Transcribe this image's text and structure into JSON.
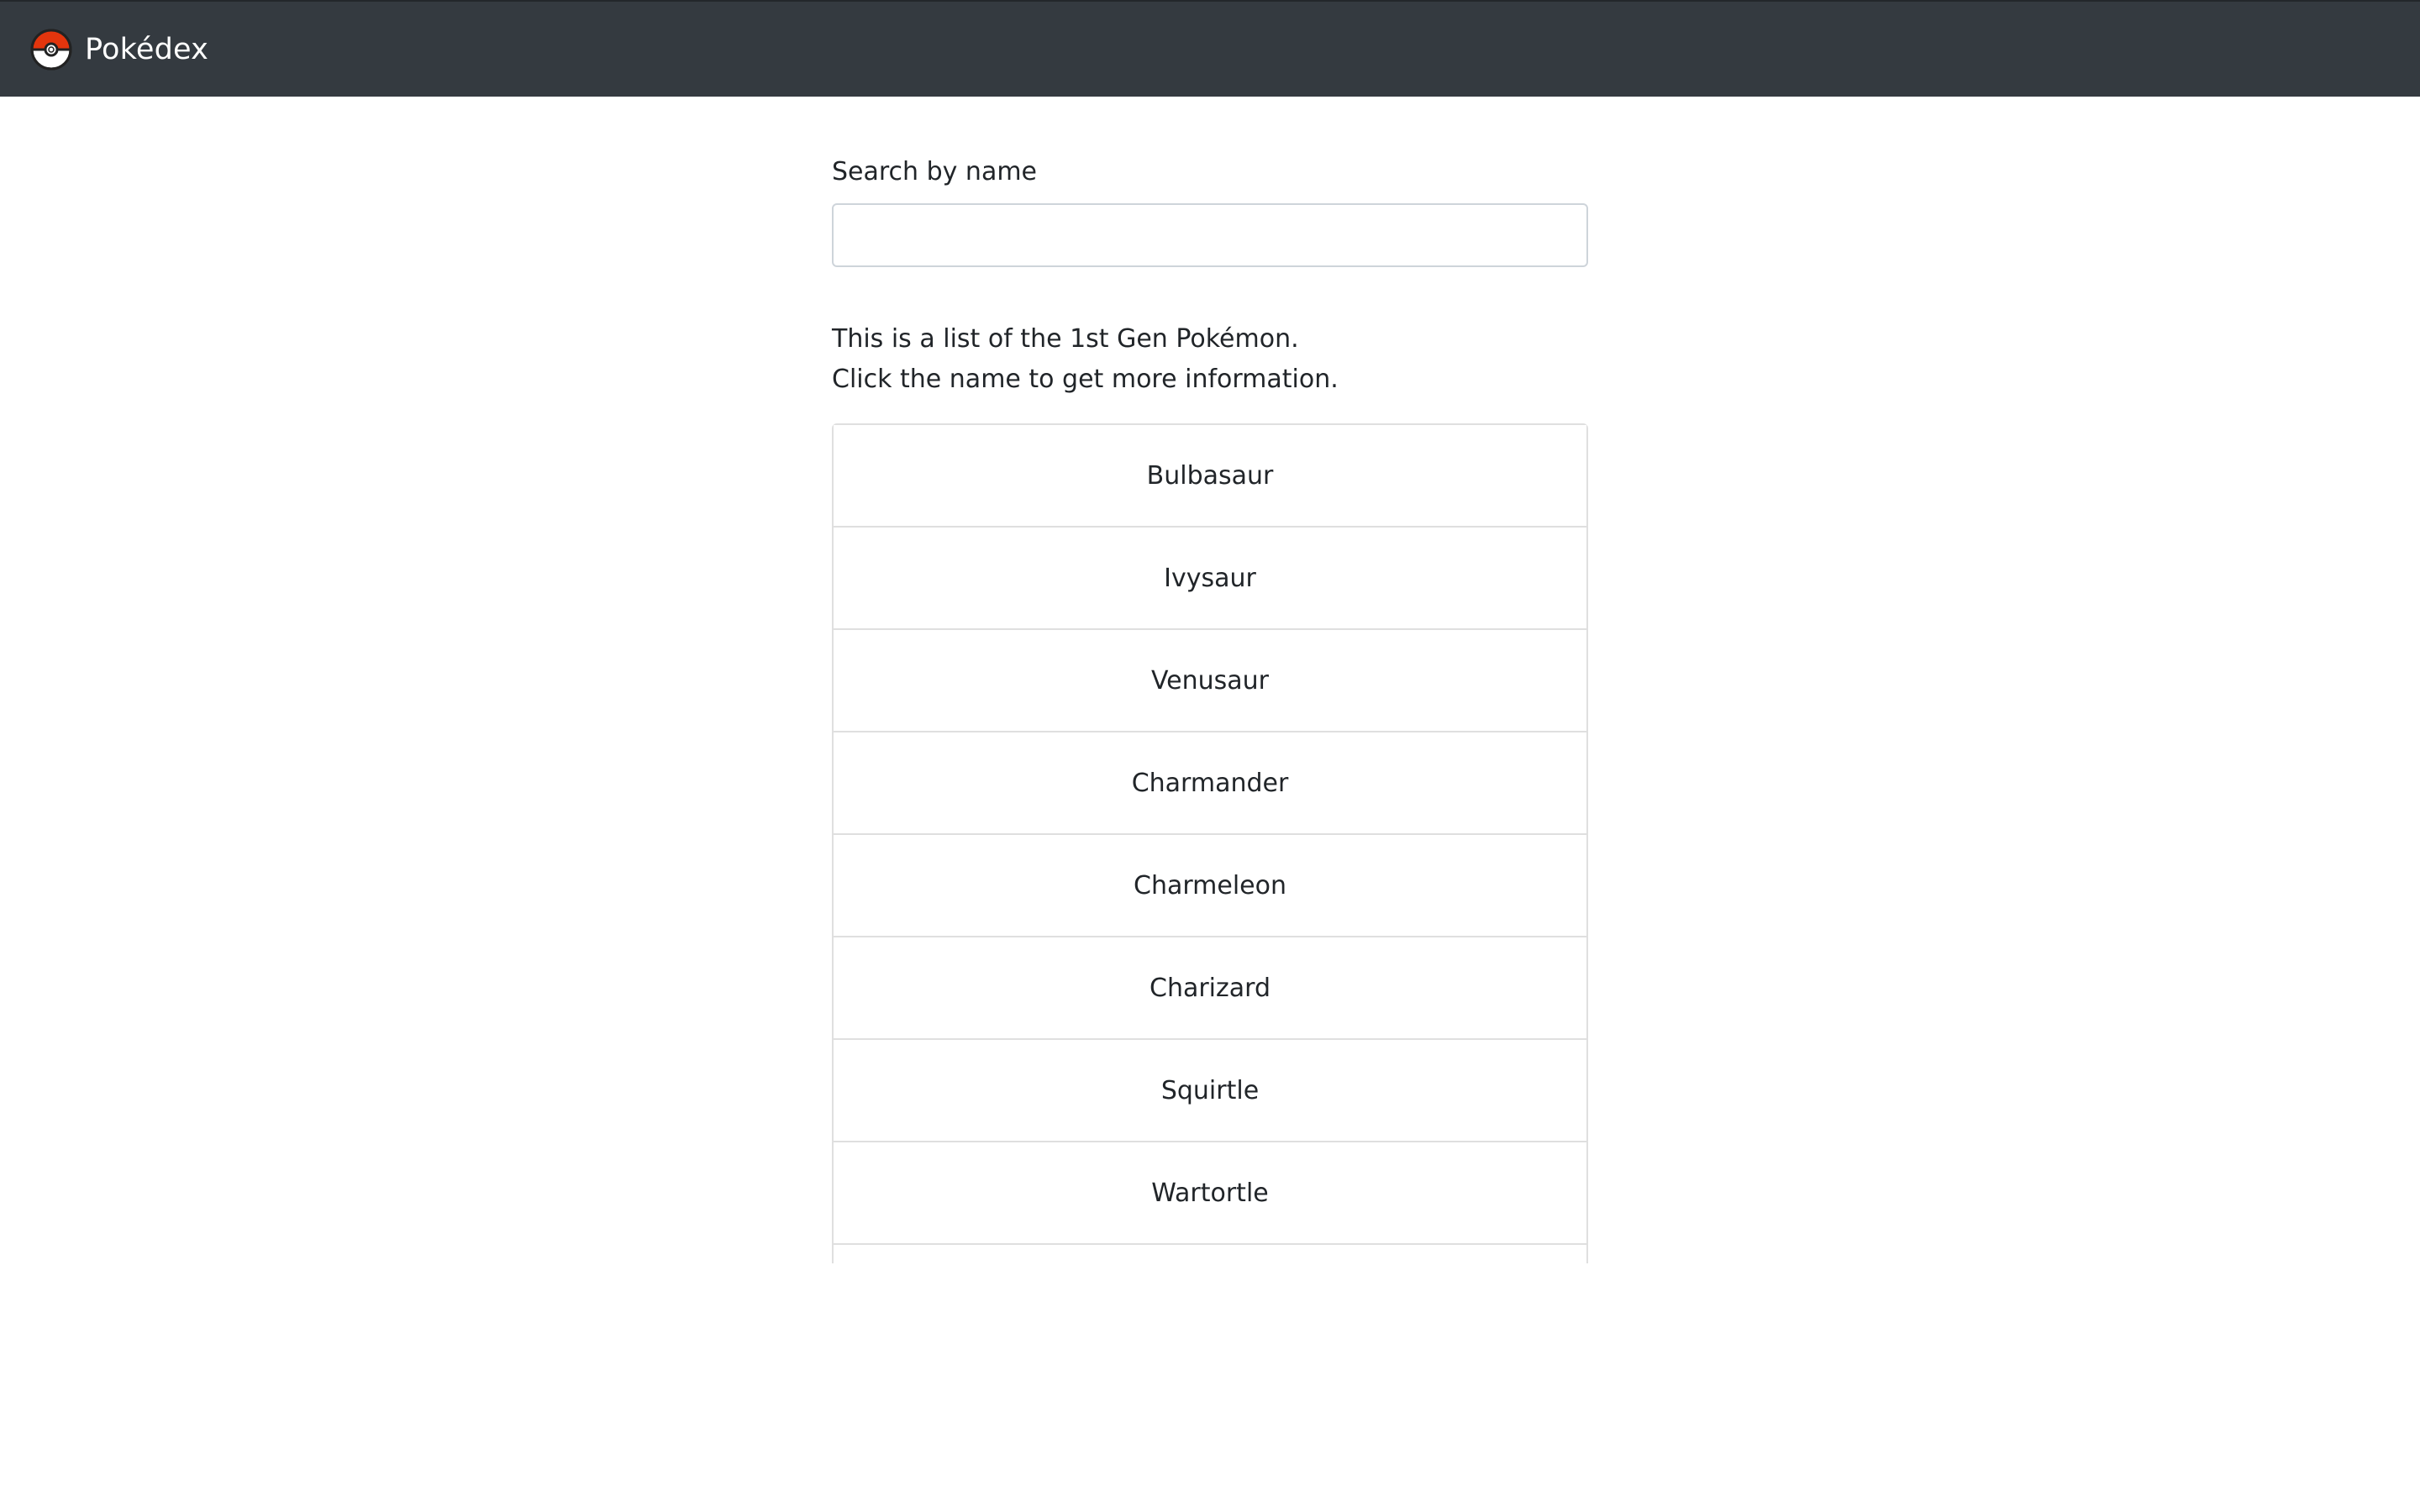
{
  "navbar": {
    "brand": "Pokédex",
    "logo_icon": "pokeball-icon",
    "background": "#343a40"
  },
  "search": {
    "label": "Search by name",
    "value": "",
    "placeholder": ""
  },
  "intro": {
    "line1": "This is a list of the 1st Gen Pokémon.",
    "line2": "Click the name to get more information."
  },
  "pokemon": [
    "Bulbasaur",
    "Ivysaur",
    "Venusaur",
    "Charmander",
    "Charmeleon",
    "Charizard",
    "Squirtle",
    "Wartortle",
    ""
  ]
}
